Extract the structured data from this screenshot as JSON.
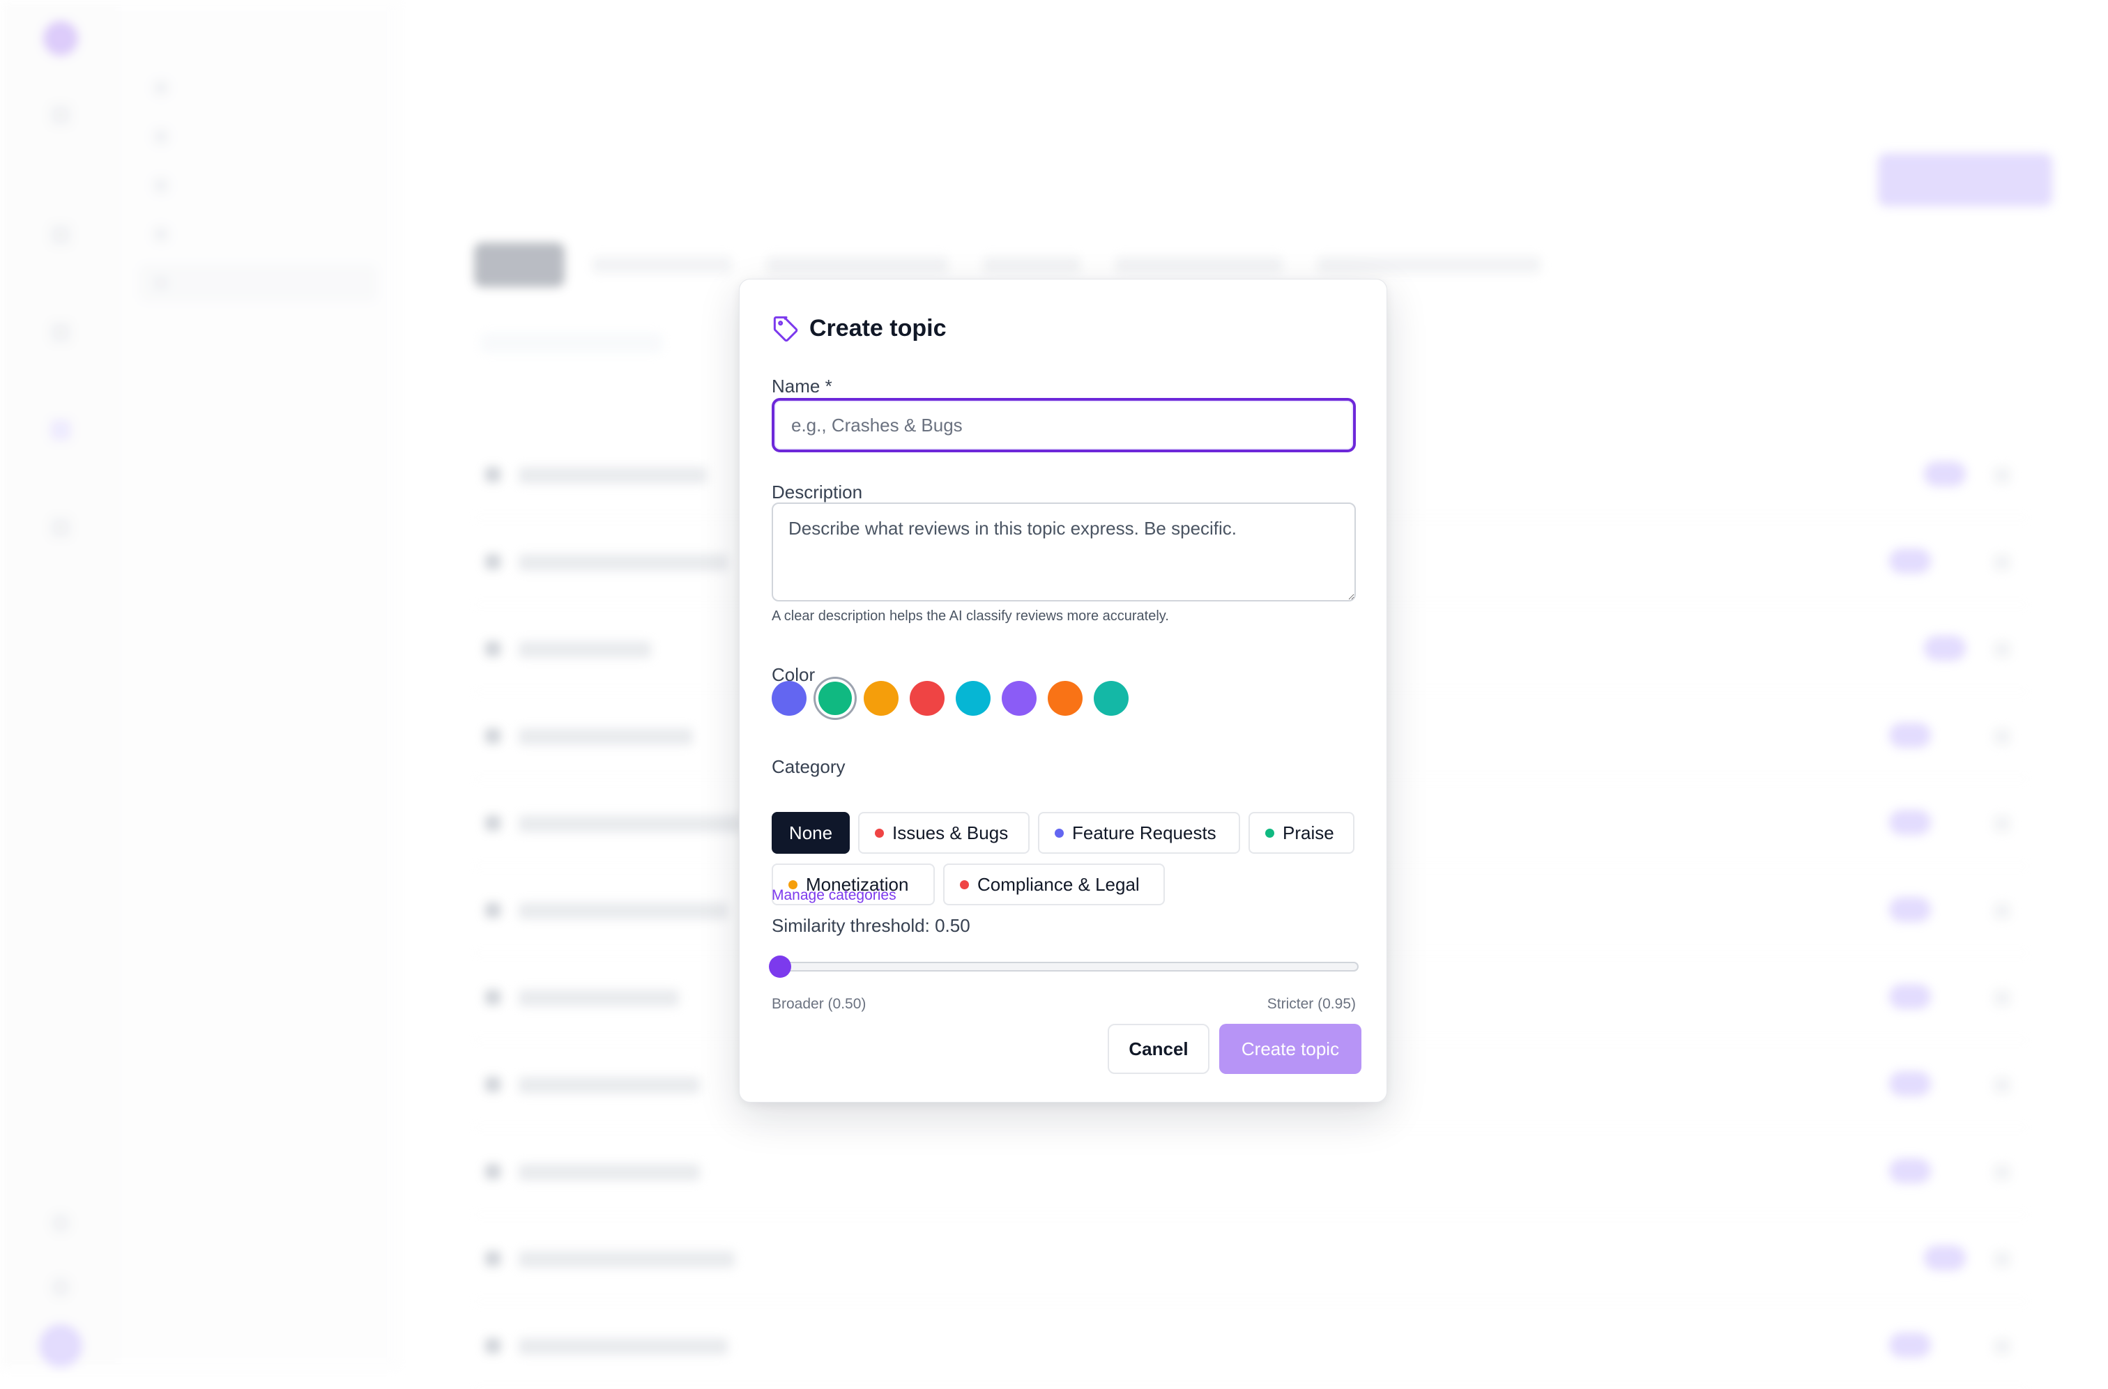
{
  "modal": {
    "title": "Create topic",
    "name_label": "Name *",
    "name_placeholder": "e.g., Crashes & Bugs",
    "name_value": "",
    "description_label": "Description",
    "description_placeholder": "Describe what reviews in this topic express. Be specific.",
    "description_value": "",
    "description_hint": "A clear description helps the AI classify reviews more accurately.",
    "color_label": "Color",
    "colors": [
      {
        "icon": "color-swatch",
        "hex": "#6366f1",
        "selected": false
      },
      {
        "icon": "color-swatch",
        "hex": "#10b981",
        "selected": true
      },
      {
        "icon": "color-swatch",
        "hex": "#f59e0b",
        "selected": false
      },
      {
        "icon": "color-swatch",
        "hex": "#ef4444",
        "selected": false
      },
      {
        "icon": "color-swatch",
        "hex": "#06b6d4",
        "selected": false
      },
      {
        "icon": "color-swatch",
        "hex": "#8b5cf6",
        "selected": false
      },
      {
        "icon": "color-swatch",
        "hex": "#f97316",
        "selected": false
      },
      {
        "icon": "color-swatch",
        "hex": "#14b8a6",
        "selected": false
      }
    ],
    "category_label": "Category",
    "categories": [
      {
        "label": "None",
        "dot": null,
        "active": true
      },
      {
        "label": "Issues & Bugs",
        "dot": "#ef4444",
        "active": false
      },
      {
        "label": "Feature Requests",
        "dot": "#6366f1",
        "active": false
      },
      {
        "label": "Praise",
        "dot": "#10b981",
        "active": false
      },
      {
        "label": "Monetization",
        "dot": "#f59e0b",
        "active": false
      },
      {
        "label": "Compliance & Legal",
        "dot": "#ef4444",
        "active": false
      }
    ],
    "manage_categories": "Manage categories",
    "threshold_label": "Similarity threshold: 0.50",
    "threshold_value": 0.5,
    "threshold_min": 0.5,
    "threshold_max": 0.95,
    "range_min_label": "Broader (0.50)",
    "range_max_label": "Stricter (0.95)",
    "cancel_label": "Cancel",
    "create_label": "Create topic"
  },
  "theme": {
    "accent": "#7c3aed",
    "accent_light": "#b794f6",
    "primary_dark": "#0f172a"
  }
}
